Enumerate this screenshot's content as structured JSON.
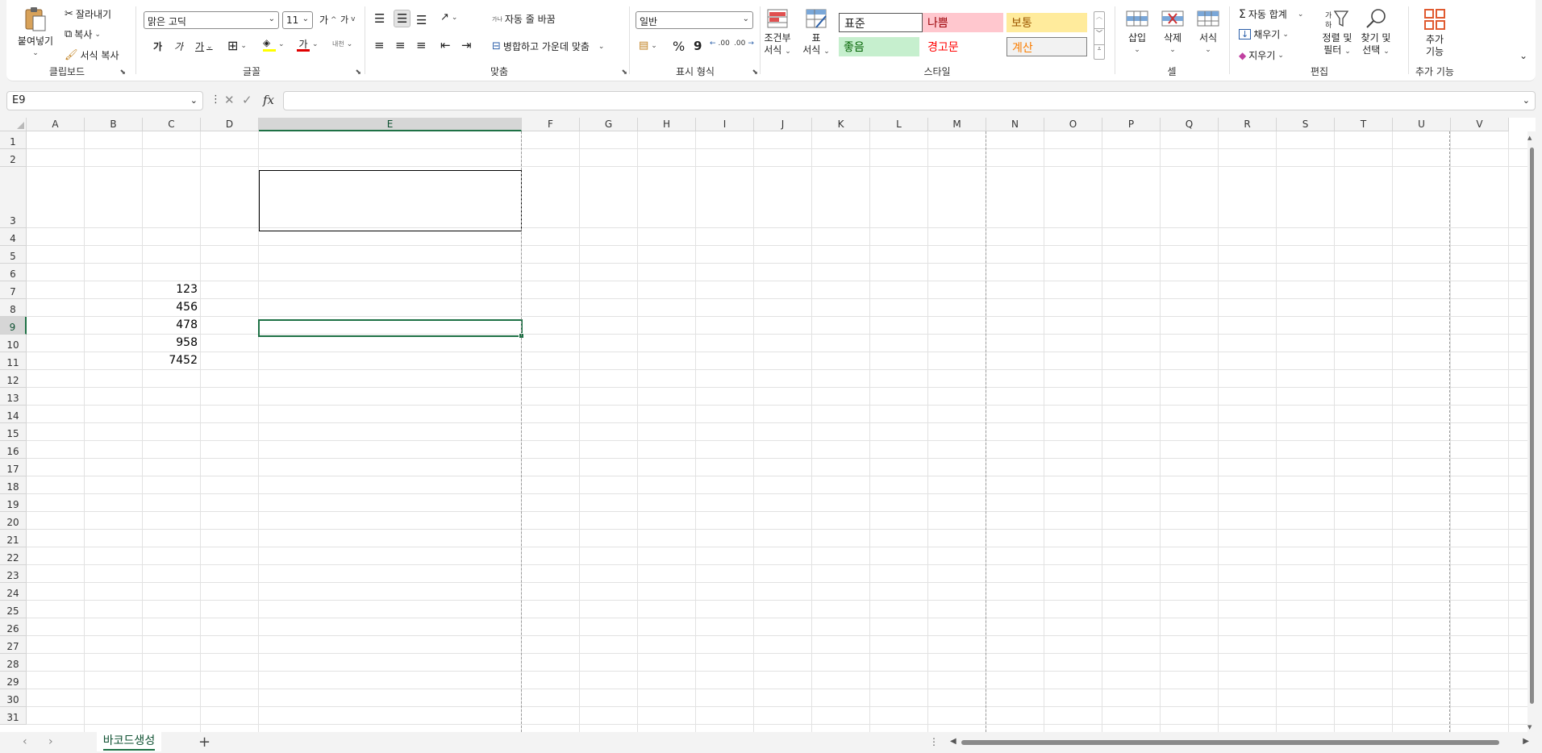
{
  "clipboard": {
    "paste": "붙여넣기",
    "cut": "잘라내기",
    "copy": "복사",
    "format_painter": "서식 복사",
    "label": "클립보드"
  },
  "font": {
    "name": "맑은 고딕",
    "size": "11",
    "grow": "가",
    "shrink": "가",
    "bold": "가",
    "italic": "가",
    "underline": "가",
    "font_color_glyph": "가",
    "phonetic": "내천",
    "label": "글꼴",
    "colors": {
      "highlight": "#ffff00",
      "font": "#e00000"
    }
  },
  "alignment": {
    "wrap_text": "자동 줄 바꿈",
    "merge_center": "병합하고 가운데 맞춤",
    "wrap_glyph": "가나",
    "label": "맞춤"
  },
  "number": {
    "format": "일반",
    "percent": "%",
    "comma": "9",
    "inc_decimal": ".00",
    "dec_decimal": ".00",
    "label": "표시 형식"
  },
  "styles": {
    "conditional_1": "조건부",
    "conditional_2": "서식",
    "table_1": "표",
    "table_2": "서식",
    "normal": "표준",
    "bad": "나쁨",
    "neutral": "보통",
    "good": "좋음",
    "warning": "경고문",
    "calculation": "계산",
    "label": "스타일",
    "colors": {
      "bad_bg": "#ffc7ce",
      "bad_fg": "#9c0006",
      "neutral_bg": "#ffeb9c",
      "neutral_fg": "#9c5700",
      "good_bg": "#c6efce",
      "good_fg": "#006100",
      "warning_fg": "#ff0000",
      "calc_bg": "#f2f2f2",
      "calc_fg": "#fa7d00"
    }
  },
  "cells": {
    "insert": "삽입",
    "delete": "삭제",
    "format": "서식",
    "label": "셀"
  },
  "editing": {
    "autosum": "자동 합계",
    "fill": "채우기",
    "clear": "지우기",
    "sort_1": "정렬 및",
    "sort_2": "필터",
    "find_1": "찾기 및",
    "find_2": "선택",
    "label": "편집"
  },
  "addins": {
    "btn_1": "추가",
    "btn_2": "기능",
    "label": "추가 기능"
  },
  "formula_bar": {
    "name_box": "E9",
    "fx": "fx",
    "formula": ""
  },
  "sheet": {
    "columns": [
      "A",
      "B",
      "C",
      "D",
      "E",
      "F",
      "G",
      "H",
      "I",
      "J",
      "K",
      "L",
      "M",
      "N",
      "O",
      "P",
      "Q",
      "R",
      "S",
      "T",
      "U",
      "V"
    ],
    "rows": [
      "1",
      "2",
      "3",
      "4",
      "5",
      "6",
      "7",
      "8",
      "9",
      "10",
      "11",
      "12",
      "13",
      "14",
      "15",
      "16",
      "17",
      "18",
      "19",
      "20",
      "21",
      "22",
      "23",
      "24",
      "25",
      "26",
      "27",
      "28",
      "29",
      "30",
      "31"
    ],
    "selected_cell": "E9",
    "values": [
      {
        "cell": "C7",
        "value": "123"
      },
      {
        "cell": "C8",
        "value": "456"
      },
      {
        "cell": "C9",
        "value": "478"
      },
      {
        "cell": "C10",
        "value": "958"
      },
      {
        "cell": "C11",
        "value": "7452"
      }
    ],
    "tab_name": "바코드생성",
    "accent": "#1e7145"
  }
}
